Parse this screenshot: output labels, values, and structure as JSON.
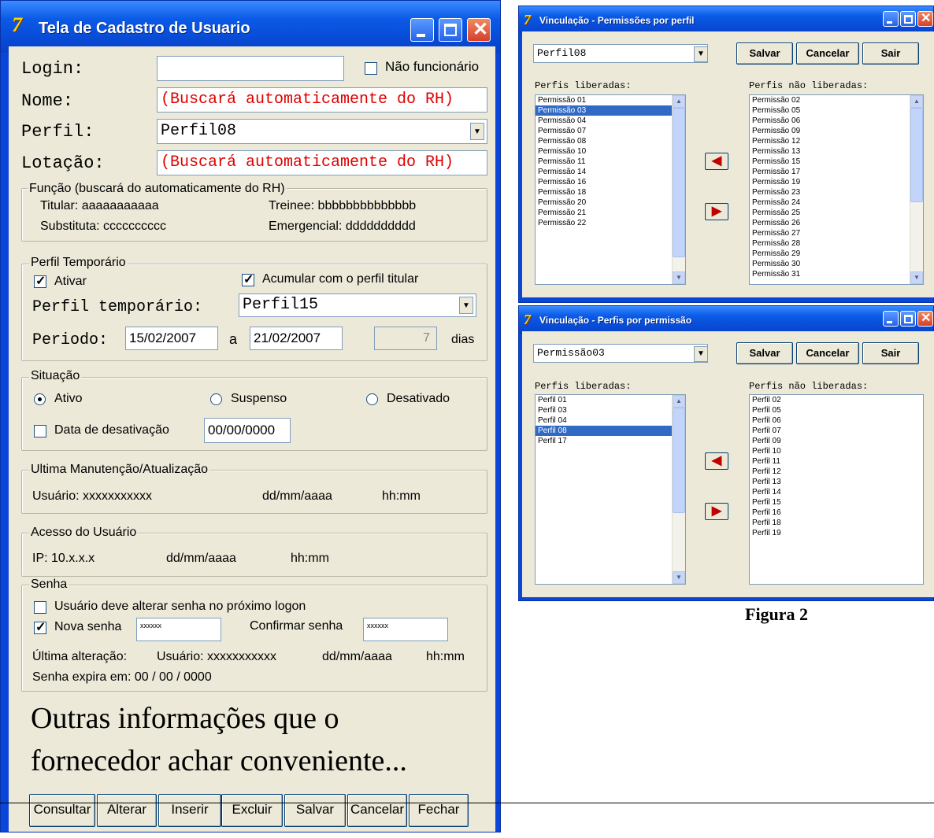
{
  "cadastro": {
    "title": "Tela de Cadastro de Usuario",
    "login_label": "Login:",
    "login_value": "",
    "nao_funcionario_label": "Não funcionário",
    "nome_label": "Nome:",
    "nome_value": "(Buscará automaticamente do RH)",
    "perfil_label": "Perfil:",
    "perfil_value": "Perfil08",
    "lotacao_label": "Lotação:",
    "lotacao_value": "(Buscará automaticamente do RH)",
    "funcao": {
      "legend": "Função (buscará do automaticamente do RH)",
      "titular": "Titular:  aaaaaaaaaaa",
      "trainee": "Treinee: bbbbbbbbbbbbbb",
      "substituta": "Substituta: cccccccccc",
      "emergencial": "Emergencial: dddddddddd"
    },
    "temporario": {
      "legend": "Perfil Temporário",
      "ativar_label": "Ativar",
      "acumular_label": "Acumular com o perfil titular",
      "perfil_label": "Perfil temporário:",
      "perfil_value": "Perfil15",
      "periodo_label": "Periodo:",
      "data_inicio": "15/02/2007",
      "a_label": "a",
      "data_fim": "21/02/2007",
      "dias_value": "7",
      "dias_label": "dias"
    },
    "situacao": {
      "legend": "Situação",
      "ativo": "Ativo",
      "suspenso": "Suspenso",
      "desativado": "Desativado",
      "data_desativacao_label": "Data de desativação",
      "data_desativacao_value": "00/00/0000"
    },
    "manutencao": {
      "legend": "Ultima Manutenção/Atualização",
      "usuario": "Usuário:  xxxxxxxxxxx",
      "data": "dd/mm/aaaa",
      "hora": "hh:mm"
    },
    "acesso": {
      "legend": "Acesso do Usuário",
      "ip": "IP: 10.x.x.x",
      "data": "dd/mm/aaaa",
      "hora": "hh:mm"
    },
    "senha": {
      "legend": "Senha",
      "alterar_label": "Usuário deve alterar senha no próximo logon",
      "nova_label": "Nova senha",
      "nova_value": "xxxxxx",
      "confirmar_label": "Confirmar senha",
      "confirmar_value": "xxxxxx",
      "ultima_label": "Última alteração:",
      "ultima_usuario": "Usuário:  xxxxxxxxxxx",
      "ultima_data": "dd/mm/aaaa",
      "ultima_hora": "hh:mm",
      "expira": "Senha expira em:  00 / 00 / 0000"
    },
    "outras_line1": "Outras informações que o",
    "outras_line2": "fornecedor achar conveniente...",
    "buttons": [
      "Consultar",
      "Alterar",
      "Inserir",
      "Excluir",
      "Salvar",
      "Cancelar",
      "Fechar"
    ]
  },
  "perm_por_perfil": {
    "title": "Vinculação - Permissões por perfil",
    "combo_value": "Perfil08",
    "salvar": "Salvar",
    "cancelar": "Cancelar",
    "sair": "Sair",
    "liberadas_label": "Perfis liberadas:",
    "nao_liberadas_label": "Perfis não liberadas:",
    "liberadas": [
      "Permissão 01",
      "Permissão 03",
      "Permissão 04",
      "Permissão 07",
      "Permissão 08",
      "Permissão 10",
      "Permissão 11",
      "Permissão 14",
      "Permissão 16",
      "Permissão 18",
      "Permissão 20",
      "Permissão 21",
      "Permissão 22"
    ],
    "nao_liberadas": [
      "Permissão 02",
      "Permissão 05",
      "Permissão 06",
      "Permissão 09",
      "Permissão 12",
      "Permissão 13",
      "Permissão 15",
      "Permissão 17",
      "Permissão 19",
      "Permissão 23",
      "Permissão 24",
      "Permissão 25",
      "Permissão 26",
      "Permissão 27",
      "Permissão 28",
      "Permissão 29",
      "Permissão 30",
      "Permissão 31"
    ]
  },
  "perfis_por_perm": {
    "title": "Vinculação - Perfis por permissão",
    "combo_value": "Permissão03",
    "salvar": "Salvar",
    "cancelar": "Cancelar",
    "sair": "Sair",
    "liberadas_label": "Perfis liberadas:",
    "nao_liberadas_label": "Perfis não liberadas:",
    "liberadas": [
      "Perfil 01",
      "Perfil 03",
      "Perfil 04",
      "Perfil 08",
      "Perfil 17"
    ],
    "nao_liberadas": [
      "Perfil 02",
      "Perfil 05",
      "Perfil 06",
      "Perfil 07",
      "Perfil 09",
      "Perfil 10",
      "Perfil 11",
      "Perfil 12",
      "Perfil 13",
      "Perfil 14",
      "Perfil 15",
      "Perfil 16",
      "Perfil 18",
      "Perfil 19"
    ]
  },
  "figura_caption": "Figura 2",
  "colors": {
    "titlebar": "#0a5ae6",
    "window_bg": "#ece9d8",
    "red_text": "#e00000",
    "selection": "#316ac5"
  }
}
